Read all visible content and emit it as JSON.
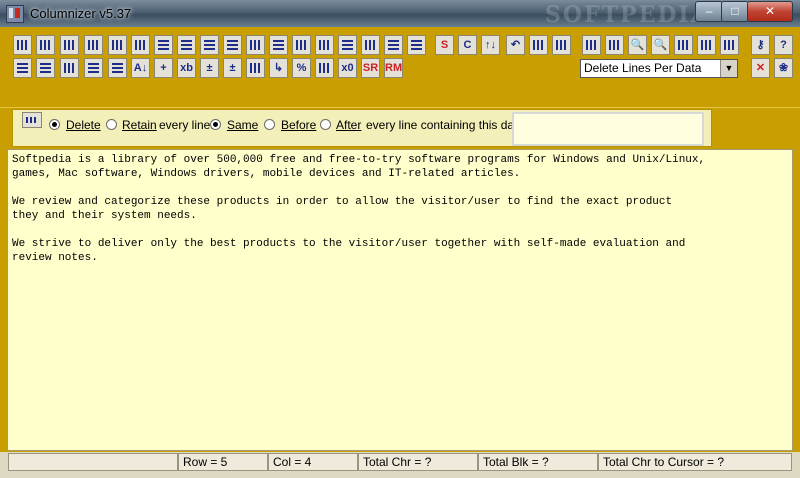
{
  "window": {
    "title": "Columnizer v5.37",
    "watermark": "SOFTPEDIA",
    "controls": {
      "minimize": "–",
      "maximize": "□",
      "close": "✕"
    }
  },
  "toolbar": {
    "letter_buttons": {
      "s": "S",
      "c": "C",
      "x0": "x0",
      "sr": "SR",
      "rm": "RM",
      "pct": "%",
      "arrows": "↑↓"
    },
    "operation_select": {
      "selected": "Delete Lines Per Data",
      "arrow": "▼"
    }
  },
  "options": {
    "delete_label": "Delete",
    "retain_label": "Retain",
    "every_line_label": "every line:",
    "same_label": "Same",
    "before_label": "Before",
    "after_label": "After",
    "containing_label": "every line containing this data:",
    "delete_selected": true,
    "same_selected": true,
    "data_value": ""
  },
  "editor": {
    "lines": [
      "Softpedia is a library of over 500,000 free and free-to-try software programs for Windows and Unix/Linux,",
      "games, Mac software, Windows drivers, mobile devices and IT-related articles.",
      "",
      "We review and categorize these products in order to allow the visitor/user to find the exact product",
      "they and their system needs.",
      "",
      "We strive to deliver only the best products to the visitor/user together with self-made evaluation and",
      "review notes."
    ]
  },
  "status": {
    "row": "Row = 5",
    "col": "Col = 4",
    "total_chr": "Total Chr = ?",
    "total_blk": "Total Blk = ?",
    "total_chr_cursor": "Total Chr to Cursor = ?"
  }
}
